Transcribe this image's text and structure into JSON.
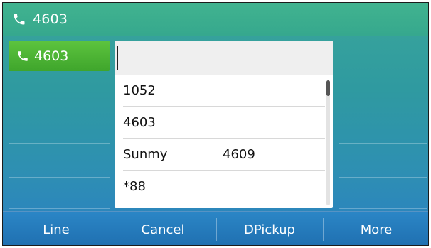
{
  "header": {
    "number": "4603",
    "icon": "phone-icon"
  },
  "line_key": {
    "label": "4603",
    "icon": "phone-icon",
    "color": "#4fb735"
  },
  "search": {
    "value": ""
  },
  "suggestions": [
    {
      "name": "1052",
      "ext": ""
    },
    {
      "name": "4603",
      "ext": ""
    },
    {
      "name": "Sunmy",
      "ext": "4609"
    },
    {
      "name": "*88",
      "ext": ""
    }
  ],
  "softkeys": [
    {
      "label": "Line"
    },
    {
      "label": "Cancel"
    },
    {
      "label": "DPickup"
    },
    {
      "label": "More"
    }
  ]
}
